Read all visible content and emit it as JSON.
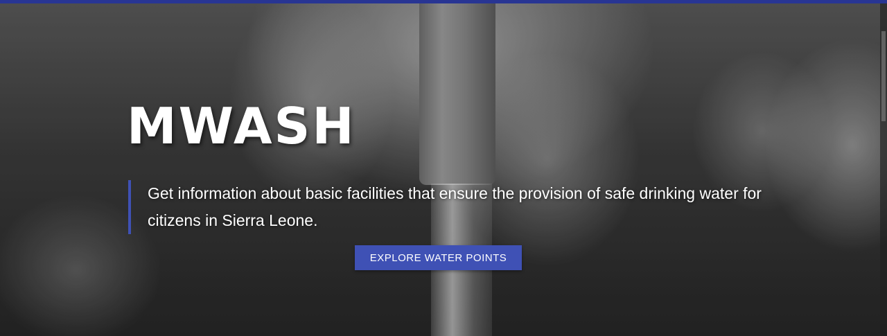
{
  "hero": {
    "title": "MWASH",
    "tagline": "Get information about basic facilities that ensure the provision of safe drinking water for citizens in Sierra Leone.",
    "cta_label": "EXPLORE WATER POINTS"
  },
  "colors": {
    "accent": "#3f51b5",
    "topbar": "#283593"
  }
}
